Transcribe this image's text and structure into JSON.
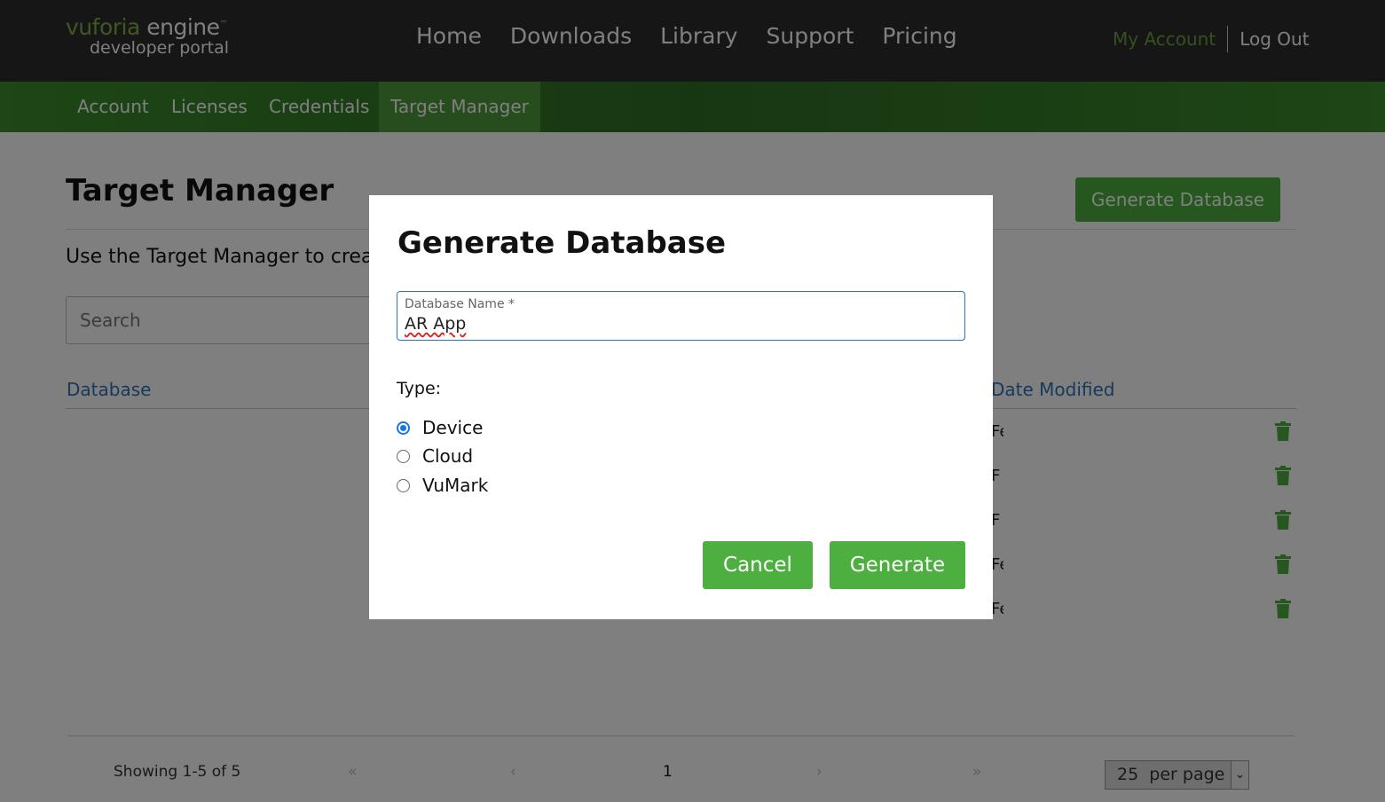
{
  "header": {
    "logo_brand": "vuforia",
    "logo_engine": "engine",
    "logo_tm": "™",
    "logo_sub": "developer portal",
    "nav": [
      "Home",
      "Downloads",
      "Library",
      "Support",
      "Pricing"
    ],
    "my_account": "My Account",
    "log_out": "Log Out"
  },
  "subnav": {
    "items": [
      "Account",
      "Licenses",
      "Credentials",
      "Target Manager"
    ],
    "active": "Target Manager"
  },
  "page": {
    "title": "Target Manager",
    "generate_database_button": "Generate Database",
    "intro": "Use the Target Manager to create",
    "search_placeholder": "Search",
    "columns": {
      "database": "Database",
      "date_modified": "Date Modified"
    },
    "row_dates": [
      "Fe",
      "F",
      "F",
      "Fe",
      "Fe"
    ]
  },
  "pagination": {
    "showing": "Showing 1-5 of 5",
    "first": "«",
    "prev": "‹",
    "current": "1",
    "next": "›",
    "last": "»",
    "per_page_value": "25",
    "per_page_label": "per page"
  },
  "modal": {
    "title": "Generate Database",
    "field_label": "Database Name *",
    "field_value": "AR App",
    "type_label": "Type:",
    "types": [
      {
        "label": "Device",
        "checked": true
      },
      {
        "label": "Cloud",
        "checked": false
      },
      {
        "label": "VuMark",
        "checked": false
      }
    ],
    "cancel": "Cancel",
    "generate": "Generate"
  },
  "colors": {
    "topbar": "#2d2d2d",
    "subnav": "#3c8c2c",
    "accent_green": "#4caf3f",
    "link_blue": "#2f72b8",
    "radio_blue": "#1a73e8"
  }
}
